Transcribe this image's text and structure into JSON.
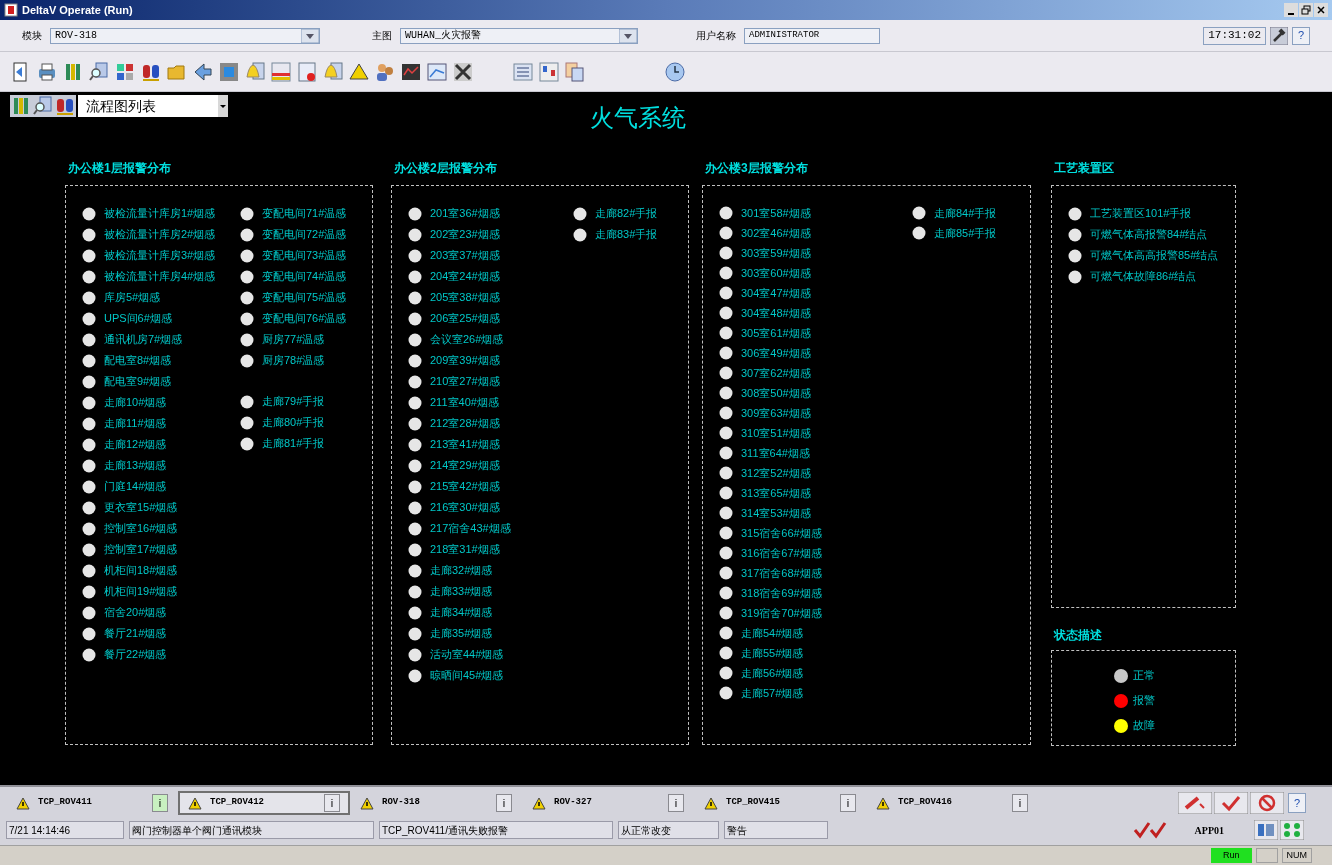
{
  "window": {
    "title": "DeltaV Operate (Run)"
  },
  "header": {
    "module_label": "模块",
    "module_value": "ROV-318",
    "picture_label": "主图",
    "picture_value": "WUHAN_火灾报警",
    "user_label": "用户名称",
    "user_value": "ADMINISTRATOR",
    "time": "17:31:02",
    "help": "?"
  },
  "display_list": {
    "value": "流程图列表"
  },
  "page_title": "火气系统",
  "panels": [
    {
      "title": "办公楼1层报警分布",
      "columns": [
        {
          "groups": [
            {
              "points": [
                {
                  "label": "被检流量计库房1#烟感",
                  "alarm": false,
                  "fault": false
                },
                {
                  "label": "被检流量计库房2#烟感",
                  "alarm": false,
                  "fault": false
                },
                {
                  "label": "被检流量计库房3#烟感",
                  "alarm": false,
                  "fault": false
                },
                {
                  "label": "被检流量计库房4#烟感",
                  "alarm": false,
                  "fault": false
                },
                {
                  "label": "库房5#烟感",
                  "alarm": false,
                  "fault": false
                },
                {
                  "label": "UPS间6#烟感",
                  "alarm": false,
                  "fault": false
                },
                {
                  "label": "通讯机房7#烟感",
                  "alarm": false,
                  "fault": false
                },
                {
                  "label": "配电室8#烟感",
                  "alarm": false,
                  "fault": false
                },
                {
                  "label": "配电室9#烟感",
                  "alarm": false,
                  "fault": false
                },
                {
                  "label": "走廊10#烟感",
                  "alarm": false,
                  "fault": false
                },
                {
                  "label": "走廊11#烟感",
                  "alarm": false,
                  "fault": false
                },
                {
                  "label": "走廊12#烟感",
                  "alarm": false,
                  "fault": false
                },
                {
                  "label": "走廊13#烟感",
                  "alarm": false,
                  "fault": false
                },
                {
                  "label": "门庭14#烟感",
                  "alarm": false,
                  "fault": false
                },
                {
                  "label": "更衣室15#烟感",
                  "alarm": false,
                  "fault": false
                },
                {
                  "label": "控制室16#烟感",
                  "alarm": false,
                  "fault": false
                },
                {
                  "label": "控制室17#烟感",
                  "alarm": false,
                  "fault": false
                },
                {
                  "label": "机柜间18#烟感",
                  "alarm": false,
                  "fault": false
                },
                {
                  "label": "机柜间19#烟感",
                  "alarm": false,
                  "fault": false
                },
                {
                  "label": "宿舍20#烟感",
                  "alarm": false,
                  "fault": false
                },
                {
                  "label": "餐厅21#烟感",
                  "alarm": false,
                  "fault": false
                },
                {
                  "label": "餐厅22#烟感",
                  "alarm": false,
                  "fault": false
                }
              ]
            }
          ]
        },
        {
          "groups": [
            {
              "points": [
                {
                  "label": "变配电间71#温感",
                  "alarm": false,
                  "fault": false
                },
                {
                  "label": "变配电间72#温感",
                  "alarm": false,
                  "fault": false
                },
                {
                  "label": "变配电间73#温感",
                  "alarm": false,
                  "fault": false
                },
                {
                  "label": "变配电间74#温感",
                  "alarm": false,
                  "fault": false
                },
                {
                  "label": "变配电间75#温感",
                  "alarm": false,
                  "fault": false
                },
                {
                  "label": "变配电间76#温感",
                  "alarm": false,
                  "fault": false
                },
                {
                  "label": "厨房77#温感",
                  "alarm": false,
                  "fault": false
                },
                {
                  "label": "厨房78#温感",
                  "alarm": false,
                  "fault": false
                }
              ]
            },
            {
              "points": [
                {
                  "label": "走廊79#手报",
                  "alarm": false,
                  "fault": false
                },
                {
                  "label": "走廊80#手报",
                  "alarm": false,
                  "fault": false
                },
                {
                  "label": "走廊81#手报",
                  "alarm": false,
                  "fault": false
                }
              ]
            }
          ]
        }
      ]
    },
    {
      "title": "办公楼2层报警分布",
      "columns": [
        {
          "groups": [
            {
              "points": [
                {
                  "label": "201室36#烟感",
                  "alarm": false,
                  "fault": false
                },
                {
                  "label": "202室23#烟感",
                  "alarm": false,
                  "fault": false
                },
                {
                  "label": "203室37#烟感",
                  "alarm": false,
                  "fault": false
                },
                {
                  "label": "204室24#烟感",
                  "alarm": false,
                  "fault": false
                },
                {
                  "label": "205室38#烟感",
                  "alarm": false,
                  "fault": false
                },
                {
                  "label": "206室25#烟感",
                  "alarm": false,
                  "fault": false
                },
                {
                  "label": "会议室26#烟感",
                  "alarm": false,
                  "fault": false
                },
                {
                  "label": "209室39#烟感",
                  "alarm": false,
                  "fault": false
                },
                {
                  "label": "210室27#烟感",
                  "alarm": false,
                  "fault": false
                },
                {
                  "label": "211室40#烟感",
                  "alarm": false,
                  "fault": false
                },
                {
                  "label": "212室28#烟感",
                  "alarm": false,
                  "fault": false
                },
                {
                  "label": "213室41#烟感",
                  "alarm": false,
                  "fault": false
                },
                {
                  "label": "214室29#烟感",
                  "alarm": false,
                  "fault": false
                },
                {
                  "label": "215室42#烟感",
                  "alarm": false,
                  "fault": false
                },
                {
                  "label": "216室30#烟感",
                  "alarm": false,
                  "fault": false
                },
                {
                  "label": "217宿舍43#烟感",
                  "alarm": false,
                  "fault": false
                },
                {
                  "label": "218室31#烟感",
                  "alarm": false,
                  "fault": false
                },
                {
                  "label": "走廊32#烟感",
                  "alarm": false,
                  "fault": false
                },
                {
                  "label": "走廊33#烟感",
                  "alarm": false,
                  "fault": false
                },
                {
                  "label": "走廊34#烟感",
                  "alarm": false,
                  "fault": false
                },
                {
                  "label": "走廊35#烟感",
                  "alarm": false,
                  "fault": false
                },
                {
                  "label": "活动室44#烟感",
                  "alarm": false,
                  "fault": false
                },
                {
                  "label": "晾晒间45#烟感",
                  "alarm": false,
                  "fault": false
                }
              ]
            }
          ]
        },
        {
          "groups": [
            {
              "points": [
                {
                  "label": "走廊82#手报",
                  "alarm": false,
                  "fault": false
                },
                {
                  "label": "走廊83#手报",
                  "alarm": false,
                  "fault": false
                }
              ]
            }
          ]
        }
      ]
    },
    {
      "title": "办公楼3层报警分布",
      "columns": [
        {
          "groups": [
            {
              "points": [
                {
                  "label": "301室58#烟感",
                  "alarm": false,
                  "fault": false
                },
                {
                  "label": "302室46#烟感",
                  "alarm": false,
                  "fault": false
                },
                {
                  "label": "303室59#烟感",
                  "alarm": false,
                  "fault": false
                },
                {
                  "label": "303室60#烟感",
                  "alarm": false,
                  "fault": false
                },
                {
                  "label": "304室47#烟感",
                  "alarm": false,
                  "fault": false
                },
                {
                  "label": "304室48#烟感",
                  "alarm": false,
                  "fault": false
                },
                {
                  "label": "305室61#烟感",
                  "alarm": false,
                  "fault": false
                },
                {
                  "label": "306室49#烟感",
                  "alarm": false,
                  "fault": false
                },
                {
                  "label": "307室62#烟感",
                  "alarm": false,
                  "fault": false
                },
                {
                  "label": "308室50#烟感",
                  "alarm": false,
                  "fault": false
                },
                {
                  "label": "309室63#烟感",
                  "alarm": false,
                  "fault": false
                },
                {
                  "label": "310室51#烟感",
                  "alarm": false,
                  "fault": false
                },
                {
                  "label": "311室64#烟感",
                  "alarm": false,
                  "fault": false
                },
                {
                  "label": "312室52#烟感",
                  "alarm": false,
                  "fault": false
                },
                {
                  "label": "313室65#烟感",
                  "alarm": false,
                  "fault": false
                },
                {
                  "label": "314室53#烟感",
                  "alarm": false,
                  "fault": false
                },
                {
                  "label": "315宿舍66#烟感",
                  "alarm": false,
                  "fault": false
                },
                {
                  "label": "316宿舍67#烟感",
                  "alarm": false,
                  "fault": false
                },
                {
                  "label": "317宿舍68#烟感",
                  "alarm": false,
                  "fault": false
                },
                {
                  "label": "318宿舍69#烟感",
                  "alarm": false,
                  "fault": false
                },
                {
                  "label": "319宿舍70#烟感",
                  "alarm": false,
                  "fault": false
                },
                {
                  "label": "走廊54#烟感",
                  "alarm": false,
                  "fault": false
                },
                {
                  "label": "走廊55#烟感",
                  "alarm": false,
                  "fault": false
                },
                {
                  "label": "走廊56#烟感",
                  "alarm": false,
                  "fault": false
                },
                {
                  "label": "走廊57#烟感",
                  "alarm": false,
                  "fault": false
                }
              ]
            }
          ]
        },
        {
          "groups": [
            {
              "points": [
                {
                  "label": "走廊84#手报",
                  "alarm": false,
                  "fault": false
                },
                {
                  "label": "走廊85#手报",
                  "alarm": false,
                  "fault": false
                }
              ]
            }
          ]
        }
      ]
    },
    {
      "title": "工艺装置区",
      "columns": [
        {
          "groups": [
            {
              "points": [
                {
                  "label": "工艺装置区101#手报",
                  "alarm": false,
                  "fault": false
                },
                {
                  "label": "可燃气体高报警84#结点",
                  "alarm": false,
                  "fault": false
                },
                {
                  "label": "可燃气体高高报警85#结点",
                  "alarm": false,
                  "fault": false
                },
                {
                  "label": "可燃气体故障86#结点",
                  "alarm": false,
                  "fault": false
                }
              ]
            }
          ]
        }
      ]
    }
  ],
  "legend": {
    "title": "状态描述",
    "items": [
      {
        "label": "正常",
        "color": "#c8c8c8"
      },
      {
        "label": "报警",
        "color": "#ff0000"
      },
      {
        "label": "故障",
        "color": "#ffff00"
      }
    ]
  },
  "alarm_bar": {
    "alarms": [
      {
        "label": "TCP_ROV411",
        "selected": false,
        "acknowledged": true,
        "info": "i"
      },
      {
        "label": "TCP_ROV412",
        "selected": true,
        "acknowledged": false,
        "info": "i"
      },
      {
        "label": "ROV-318",
        "selected": false,
        "acknowledged": false,
        "info": "i"
      },
      {
        "label": "ROV-327",
        "selected": false,
        "acknowledged": false,
        "info": "i"
      },
      {
        "label": "TCP_ROV415",
        "selected": false,
        "acknowledged": false,
        "info": "i"
      },
      {
        "label": "TCP_ROV416",
        "selected": false,
        "acknowledged": false,
        "info": "i"
      }
    ],
    "help": "?",
    "message": [
      "7/21 14:14:46",
      "阀门控制器单个阀门通讯模块",
      "TCP_ROV411/通讯失败报警",
      "从正常改变",
      "警告"
    ],
    "node": "APP01"
  },
  "status_bar": {
    "mode": "Run",
    "keys": "NUM"
  }
}
